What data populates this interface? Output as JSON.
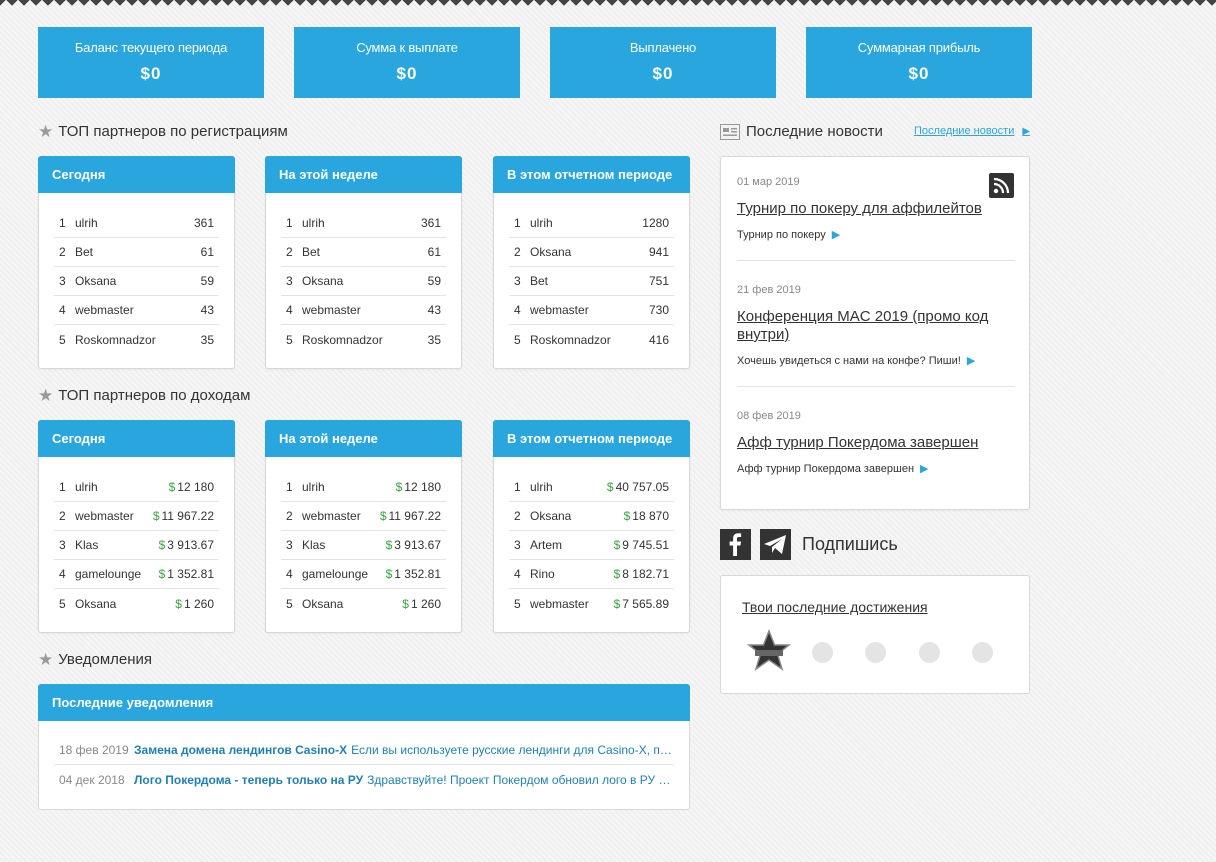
{
  "stats": [
    {
      "label": "Баланс текущего периода",
      "value": "$0"
    },
    {
      "label": "Сумма к выплате",
      "value": "$0"
    },
    {
      "label": "Выплачено",
      "value": "$0"
    },
    {
      "label": "Суммарная прибыль",
      "value": "$0"
    }
  ],
  "reg": {
    "title": "ТОП партнеров по регистрациям",
    "tables": [
      {
        "head": "Сегодня",
        "rows": [
          [
            "1",
            "ulrih",
            "361"
          ],
          [
            "2",
            "Bet",
            "61"
          ],
          [
            "3",
            "Oksana",
            "59"
          ],
          [
            "4",
            "webmaster",
            "43"
          ],
          [
            "5",
            "Roskomnadzor",
            "35"
          ]
        ]
      },
      {
        "head": "На этой неделе",
        "rows": [
          [
            "1",
            "ulrih",
            "361"
          ],
          [
            "2",
            "Bet",
            "61"
          ],
          [
            "3",
            "Oksana",
            "59"
          ],
          [
            "4",
            "webmaster",
            "43"
          ],
          [
            "5",
            "Roskomnadzor",
            "35"
          ]
        ]
      },
      {
        "head": "В этом отчетном периоде",
        "rows": [
          [
            "1",
            "ulrih",
            "1280"
          ],
          [
            "2",
            "Oksana",
            "941"
          ],
          [
            "3",
            "Bet",
            "751"
          ],
          [
            "4",
            "webmaster",
            "730"
          ],
          [
            "5",
            "Roskomnadzor",
            "416"
          ]
        ]
      }
    ]
  },
  "income": {
    "title": "ТОП партнеров по доходам",
    "currency": "$",
    "tables": [
      {
        "head": "Сегодня",
        "rows": [
          [
            "1",
            "ulrih",
            "12 180"
          ],
          [
            "2",
            "webmaster",
            "11 967.22"
          ],
          [
            "3",
            "Klas",
            "3 913.67"
          ],
          [
            "4",
            "gamelounge",
            "1 352.81"
          ],
          [
            "5",
            "Oksana",
            "1 260"
          ]
        ]
      },
      {
        "head": "На этой неделе",
        "rows": [
          [
            "1",
            "ulrih",
            "12 180"
          ],
          [
            "2",
            "webmaster",
            "11 967.22"
          ],
          [
            "3",
            "Klas",
            "3 913.67"
          ],
          [
            "4",
            "gamelounge",
            "1 352.81"
          ],
          [
            "5",
            "Oksana",
            "1 260"
          ]
        ]
      },
      {
        "head": "В этом отчетном периоде",
        "rows": [
          [
            "1",
            "ulrih",
            "40 757.05"
          ],
          [
            "2",
            "Oksana",
            "18 870"
          ],
          [
            "3",
            "Artem",
            "9 745.51"
          ],
          [
            "4",
            "Rino",
            "8 182.71"
          ],
          [
            "5",
            "webmaster",
            "7 565.89"
          ]
        ]
      }
    ]
  },
  "notifications": {
    "title": "Уведомления",
    "head": "Последние уведомления",
    "items": [
      {
        "date": "18 фев 2019",
        "title": "Замена домена лендингов Casino-X",
        "text": "Если вы используете русские лендинги для Casino-X, пожалуйста, ..."
      },
      {
        "date": "04 дек 2018",
        "title": "Лого Покердома - теперь только на РУ",
        "text": "Здравствуйте! Проект Покердом обновил лого в РУ версии - ис..."
      }
    ]
  },
  "news": {
    "title": "Последние новости",
    "link": "Последние новости",
    "items": [
      {
        "date": "01 мар 2019",
        "title": "Турнир по покеру для аффилейтов",
        "sub": "Турнир по покеру"
      },
      {
        "date": "21 фев 2019",
        "title": "Конференция MAC 2019 (промо код внутри)",
        "sub": "Хочешь увидеться с нами на конфе? Пиши!"
      },
      {
        "date": "08 фев 2019",
        "title": "Афф турнир Покердома завершен",
        "sub": "Афф турнир Покердома завершен"
      }
    ]
  },
  "subscribe": "Подпишись",
  "achievements": {
    "title": "Твои последние достижения"
  },
  "icons": {
    "star": "star-icon",
    "news": "newspaper-icon",
    "rss": "rss-icon",
    "facebook": "facebook-icon",
    "telegram": "telegram-icon",
    "arrow": "triangle-right-icon"
  },
  "colors": {
    "accent": "#29a6de",
    "money": "#3aa441",
    "link": "#1f7fb5"
  }
}
